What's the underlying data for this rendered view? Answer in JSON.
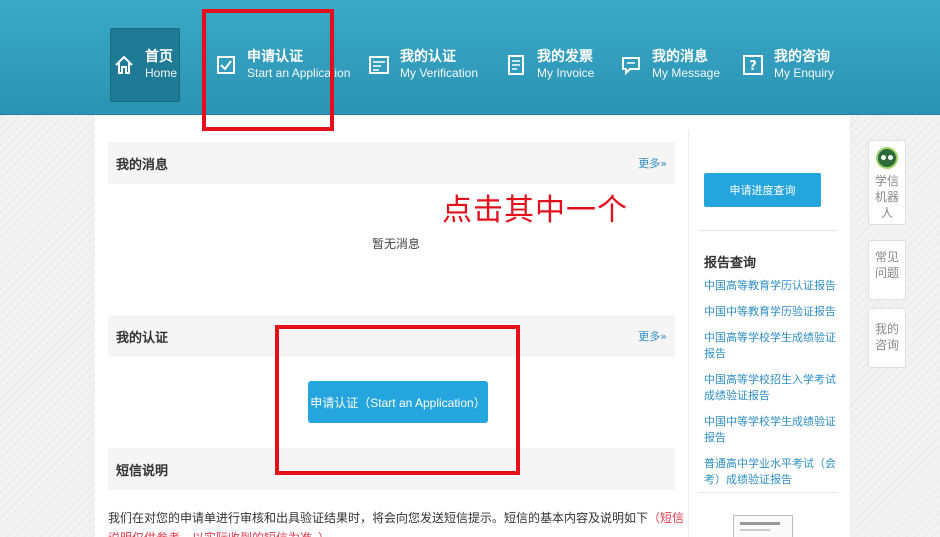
{
  "nav": {
    "items": [
      {
        "zh": "首页",
        "en": "Home",
        "icon": "home-icon"
      },
      {
        "zh": "申请认证",
        "en": "Start an Application",
        "icon": "checkbox-icon"
      },
      {
        "zh": "我的认证",
        "en": "My Verification",
        "icon": "certificate-icon"
      },
      {
        "zh": "我的发票",
        "en": "My Invoice",
        "icon": "invoice-icon"
      },
      {
        "zh": "我的消息",
        "en": "My Message",
        "icon": "message-icon"
      },
      {
        "zh": "我的咨询",
        "en": "My Enquiry",
        "icon": "question-icon"
      }
    ]
  },
  "annotation": {
    "text": "点击其中一个",
    "color": "#e3101c"
  },
  "messages": {
    "title": "我的消息",
    "more": "更多»",
    "empty": "暂无消息"
  },
  "verification": {
    "title": "我的认证",
    "more": "更多»",
    "apply_button": "申请认证（Start an Application）"
  },
  "sms": {
    "title": "短信说明",
    "text": "我们在对您的申请单进行审核和出具验证结果时，将会向您发送短信提示。短信的基本内容及说明如下",
    "note": "（短信说明仅供参考，以实际收到的短信为准。）"
  },
  "sidebar": {
    "progress_button": "申请进度查询",
    "report_title": "报告查询",
    "reports": [
      "中国高等教育学历认证报告",
      "中国中等教育学历验证报告",
      "中国高等学校学生成绩验证报告",
      "中国高等学校招生入学考试成绩验证报告",
      "中国中等学校学生成绩验证报告",
      "普通高中学业水平考试（会考）成绩验证报告"
    ]
  },
  "widgets": {
    "robot": "学信机器人",
    "faq": "常见问题",
    "enquiry": "我的咨询"
  },
  "colors": {
    "nav": "#2b93b3",
    "accent": "#25a5dd",
    "link": "#2f8fc4",
    "annotation": "#e3101c"
  }
}
